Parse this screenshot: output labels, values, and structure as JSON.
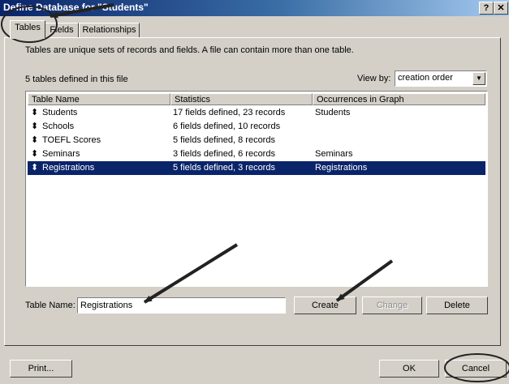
{
  "window": {
    "title": "Define Database for \"Students\"",
    "help_label": "?",
    "close_label": "✕"
  },
  "tabs": [
    {
      "label": "Tables"
    },
    {
      "label": "Fields"
    },
    {
      "label": "Relationships"
    }
  ],
  "description": "Tables are unique sets of records and fields. A file can contain more than one table.",
  "table_count": "5 tables defined in this file",
  "view_by": {
    "label": "View by:",
    "value": "creation order"
  },
  "columns": [
    "Table Name",
    "Statistics",
    "Occurrences in Graph"
  ],
  "rows": [
    {
      "name": "Students",
      "stats": "17 fields defined, 23 records",
      "occ": "Students",
      "selected": false
    },
    {
      "name": "Schools",
      "stats": "6 fields defined, 10 records",
      "occ": "",
      "selected": false
    },
    {
      "name": "TOEFL Scores",
      "stats": "5 fields defined, 8 records",
      "occ": "",
      "selected": false
    },
    {
      "name": "Seminars",
      "stats": "3 fields defined, 6 records",
      "occ": "Seminars",
      "selected": false
    },
    {
      "name": "Registrations",
      "stats": "5 fields defined, 3 records",
      "occ": "Registrations",
      "selected": true
    }
  ],
  "table_name": {
    "label": "Table Name:",
    "value": "Registrations"
  },
  "buttons": {
    "create": "Create",
    "change": "Change",
    "delete": "Delete",
    "print": "Print...",
    "ok": "OK",
    "cancel": "Cancel"
  },
  "colors": {
    "selection": "#0a246a",
    "dialog": "#d4d0c8"
  }
}
